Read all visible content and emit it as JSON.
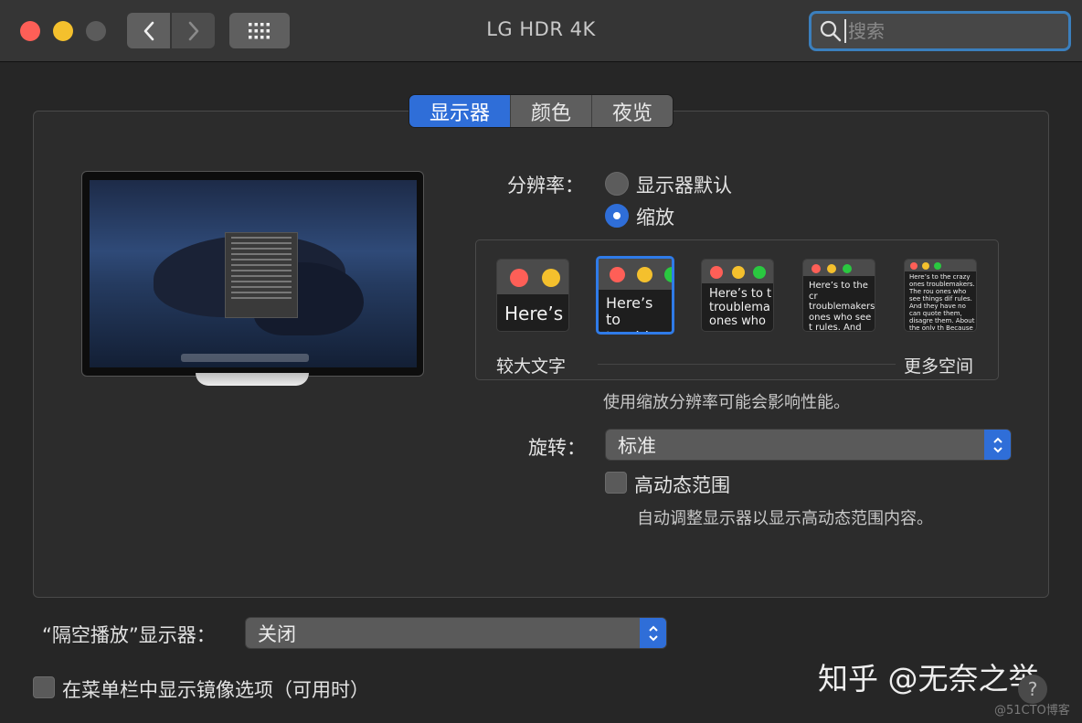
{
  "window": {
    "title": "LG HDR 4K",
    "search_placeholder": "搜索"
  },
  "tabs": [
    {
      "label": "显示器",
      "active": true
    },
    {
      "label": "颜色",
      "active": false
    },
    {
      "label": "夜览",
      "active": false
    }
  ],
  "resolution": {
    "label": "分辨率：",
    "options": [
      {
        "label": "显示器默认",
        "selected": false
      },
      {
        "label": "缩放",
        "selected": true
      }
    ],
    "scale_thumbs": [
      {
        "text": "Here’s",
        "selected": false
      },
      {
        "text": "Here’s to troublem",
        "selected": true
      },
      {
        "text": "Here’s to t troublema ones who",
        "selected": false
      },
      {
        "text": "Here’s to the cr troublemakers. ones who see t rules. And they",
        "selected": false
      },
      {
        "text": "Here’s to the crazy ones troublemakers. The rou ones who see things dif rules. And they have no can quote them, disagre them. About the only th Because they change t",
        "selected": false
      }
    ],
    "left_label": "较大文字",
    "right_label": "更多空间",
    "note": "使用缩放分辨率可能会影响性能。"
  },
  "rotation": {
    "label": "旋转：",
    "value": "标准"
  },
  "hdr": {
    "label": "高动态范围",
    "checked": false,
    "note": "自动调整显示器以显示高动态范围内容。"
  },
  "airplay": {
    "label": "“隔空播放”显示器：",
    "value": "关闭"
  },
  "mirror_option": {
    "label": "在菜单栏中显示镜像选项（可用时）",
    "checked": false
  },
  "watermark": {
    "main": "知乎 @无奈之举",
    "sub": "@51CTO博客"
  },
  "help_label": "?",
  "colors": {
    "accent": "#2f6ed8",
    "red": "#fe5f57",
    "yellow": "#f4c02d",
    "green": "#2ac840"
  }
}
